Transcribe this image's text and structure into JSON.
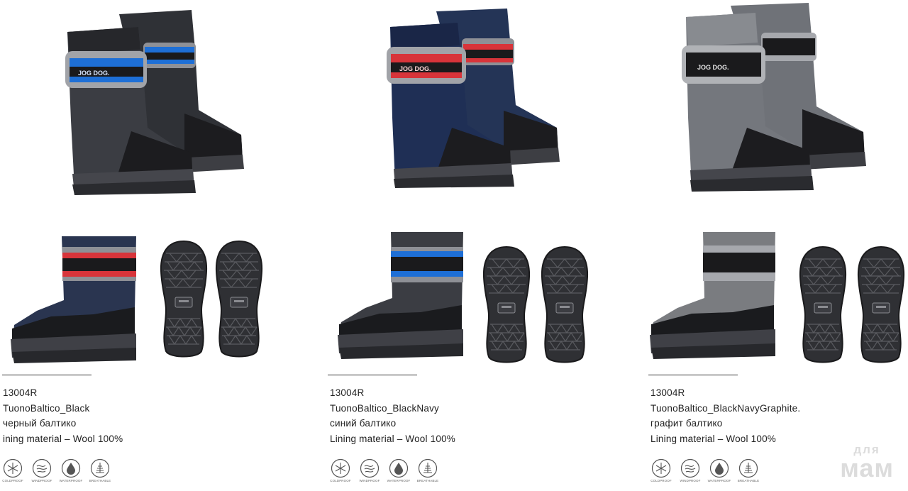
{
  "products": [
    {
      "code": "13004R",
      "name": "TuonoBaltico_Black",
      "color_ru": "черный балтико",
      "lining": "ining material – Wool 100%",
      "logo_text": "JOG DOG.",
      "colors": {
        "upper": "#3b3d43",
        "trim": "#1e6fd6",
        "side_boot_upper": "#2a3550",
        "side_boot_trim": "#d8343a"
      }
    },
    {
      "code": "13004R",
      "name": "TuonoBaltico_BlackNavy",
      "color_ru": "синий балтико",
      "lining": "Lining material – Wool 100%",
      "logo_text": "JOG DOG.",
      "colors": {
        "upper": "#1f2f55",
        "trim": "#d8343a",
        "side_boot_upper": "#3b3d43",
        "side_boot_trim": "#1e6fd6"
      }
    },
    {
      "code": "13004R",
      "name": "TuonoBaltico_BlackNavyGraphite.",
      "color_ru": "графит балтико",
      "lining": "Lining material – Wool 100%",
      "logo_text": "JOG DOG.",
      "colors": {
        "upper": "#6f7278",
        "trim": "#1a1a1a",
        "side_boot_upper": "#7a7c80",
        "side_boot_trim": "#1a1a1a"
      }
    }
  ],
  "features": [
    {
      "label": "COLDPROOF",
      "icon": "snowflake-icon"
    },
    {
      "label": "WINDPROOF",
      "icon": "wind-icon"
    },
    {
      "label": "WATERPROOF",
      "icon": "water-drop-icon"
    },
    {
      "label": "BREATHABLE",
      "icon": "breathable-icon"
    }
  ],
  "watermark": {
    "top": "для",
    "bottom": "мам"
  }
}
